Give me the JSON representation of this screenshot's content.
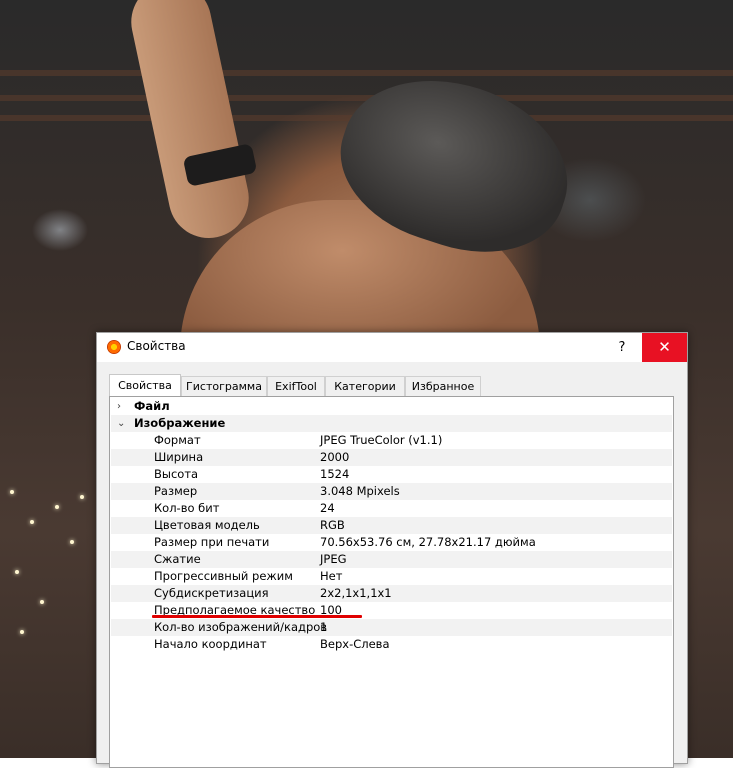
{
  "window": {
    "title": "Свойства",
    "help_label": "?",
    "close_label": "✕",
    "icon": "xnview-app-icon"
  },
  "tabs": [
    {
      "label": "Свойства",
      "active": true
    },
    {
      "label": "Гистограмма",
      "active": false
    },
    {
      "label": "ExifTool",
      "active": false
    },
    {
      "label": "Категории",
      "active": false
    },
    {
      "label": "Избранное",
      "active": false
    }
  ],
  "groups": {
    "file": {
      "label": "Файл",
      "expanded": false,
      "chevron": "›"
    },
    "image": {
      "label": "Изображение",
      "expanded": true,
      "chevron": "⌄"
    }
  },
  "properties": [
    {
      "key": "Формат",
      "value": "JPEG TrueColor (v1.1)"
    },
    {
      "key": "Ширина",
      "value": "2000"
    },
    {
      "key": "Высота",
      "value": "1524"
    },
    {
      "key": "Размер",
      "value": "3.048 Mpixels"
    },
    {
      "key": "Кол-во бит",
      "value": "24"
    },
    {
      "key": "Цветовая модель",
      "value": "RGB"
    },
    {
      "key": "Размер при печати",
      "value": "70.56x53.76 см, 27.78x21.17 дюйма"
    },
    {
      "key": "Сжатие",
      "value": "JPEG"
    },
    {
      "key": "Прогрессивный режим",
      "value": "Нет"
    },
    {
      "key": "Субдискретизация",
      "value": "2x2,1x1,1x1"
    },
    {
      "key": "Предполагаемое качество",
      "value": "100"
    },
    {
      "key": "Кол-во изображений/кадров",
      "value": "1"
    },
    {
      "key": "Начало координат",
      "value": "Верх-Слева"
    }
  ],
  "colors": {
    "close_button": "#e81123",
    "highlight_underline": "#e00000"
  }
}
